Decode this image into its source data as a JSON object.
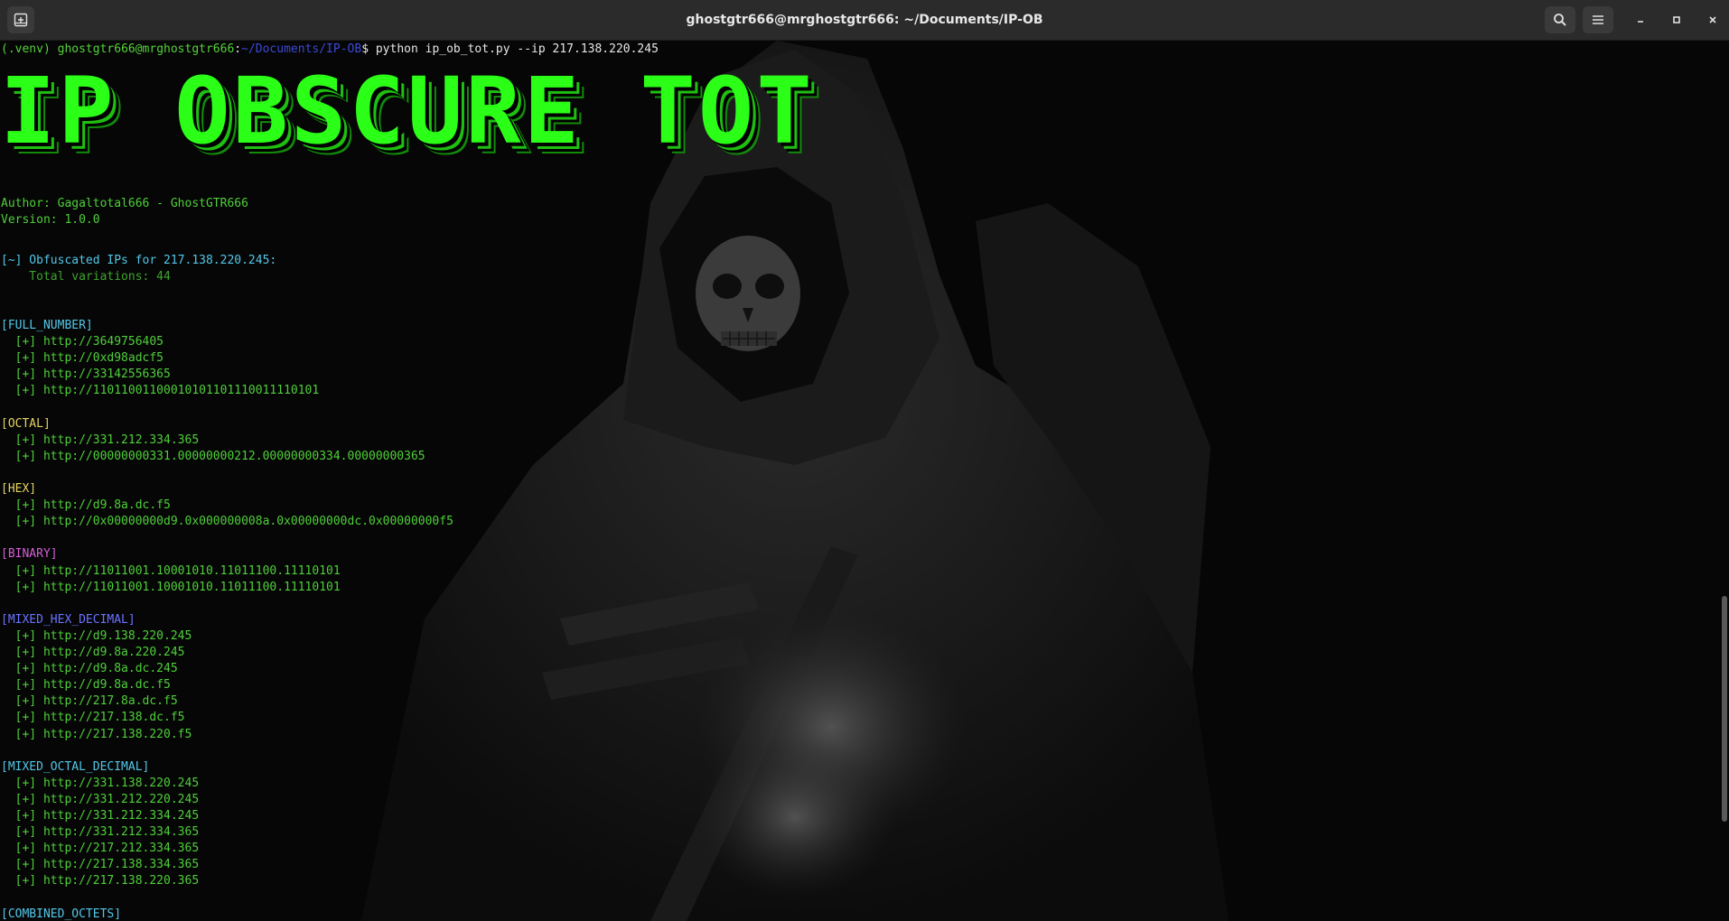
{
  "window": {
    "title": "ghostgtr666@mrghostgtr666: ~/Documents/IP-OB"
  },
  "prompt": {
    "venv": "(.venv) ",
    "user": "ghostgtr666@mrghostgtr666",
    "sep": ":",
    "path": "~/Documents/IP-OB",
    "dollar": "$ ",
    "command": "python ip_ob_tot.py --ip 217.138.220.245"
  },
  "banner": "IP OBSCURE TOT",
  "info": {
    "author": "Author: Gagaltotal666 - GhostGTR666",
    "version": "Version: 1.0.0"
  },
  "summary": {
    "heading": "[~] Obfuscated IPs for 217.138.220.245:",
    "total": "    Total variations: 44"
  },
  "sections": [
    {
      "name": "[FULL_NUMBER]",
      "items": [
        "  [+] http://3649756405",
        "  [+] http://0xd98adcf5",
        "  [+] http://33142556365",
        "  [+] http://11011001100010101101110011110101"
      ]
    },
    {
      "name": "[OCTAL]",
      "items": [
        "  [+] http://331.212.334.365",
        "  [+] http://00000000331.00000000212.00000000334.00000000365"
      ]
    },
    {
      "name": "[HEX]",
      "items": [
        "  [+] http://d9.8a.dc.f5",
        "  [+] http://0x00000000d9.0x000000008a.0x00000000dc.0x00000000f5"
      ]
    },
    {
      "name": "[BINARY]",
      "items": [
        "  [+] http://11011001.10001010.11011100.11110101",
        "  [+] http://11011001.10001010.11011100.11110101"
      ]
    },
    {
      "name": "[MIXED_HEX_DECIMAL]",
      "items": [
        "  [+] http://d9.138.220.245",
        "  [+] http://d9.8a.220.245",
        "  [+] http://d9.8a.dc.245",
        "  [+] http://d9.8a.dc.f5",
        "  [+] http://217.8a.dc.f5",
        "  [+] http://217.138.dc.f5",
        "  [+] http://217.138.220.f5"
      ]
    },
    {
      "name": "[MIXED_OCTAL_DECIMAL]",
      "items": [
        "  [+] http://331.138.220.245",
        "  [+] http://331.212.220.245",
        "  [+] http://331.212.334.245",
        "  [+] http://331.212.334.365",
        "  [+] http://217.212.334.365",
        "  [+] http://217.138.334.365",
        "  [+] http://217.138.220.365"
      ]
    },
    {
      "name": "[COMBINED_OCTETS]",
      "items": []
    }
  ],
  "colors": {
    "full_number": "#52c7e8",
    "octal": "#e6d463",
    "hex": "#e6d463",
    "binary": "#d45fd6",
    "mixed_hex_decimal": "#6b73ff",
    "mixed_octal_decimal": "#52c7e8",
    "combined_octets": "#52c7e8",
    "banner": "#2bff17"
  },
  "icons": {
    "new_tab": "new-tab-icon",
    "search": "search-icon",
    "menu": "hamburger-menu-icon",
    "minimize": "minimize-icon",
    "maximize": "maximize-icon",
    "close": "close-icon"
  }
}
